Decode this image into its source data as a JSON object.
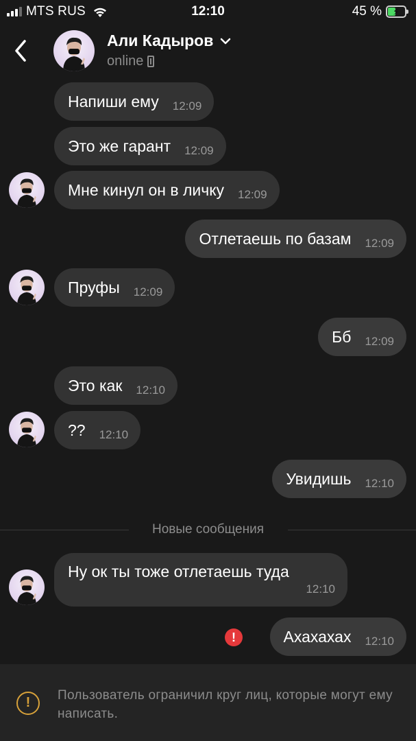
{
  "status_bar": {
    "carrier": "MTS RUS",
    "time": "12:10",
    "battery_percent": "45 %",
    "battery_level": 0.45,
    "icons": [
      "signal-icon",
      "wifi-icon",
      "battery-charging-icon"
    ]
  },
  "header": {
    "contact_name": "Али Кадыров",
    "status": "online",
    "icons": [
      "back-chevron-icon",
      "chevron-down-icon",
      "mobile-phone-icon"
    ]
  },
  "messages": [
    {
      "direction": "in",
      "text": "Напиши ему",
      "time": "12:09"
    },
    {
      "direction": "in",
      "text": "Это же гарант",
      "time": "12:09"
    },
    {
      "direction": "in",
      "text": "Мне кинул он в личку",
      "time": "12:09"
    },
    {
      "direction": "out",
      "text": "Отлетаешь по базам",
      "time": "12:09"
    },
    {
      "direction": "in",
      "text": "Пруфы",
      "time": "12:09"
    },
    {
      "direction": "out",
      "text": "Бб",
      "time": "12:09"
    },
    {
      "direction": "in",
      "text": "Это как",
      "time": "12:10"
    },
    {
      "direction": "in",
      "text": "??",
      "time": "12:10"
    },
    {
      "direction": "out",
      "text": "Увидишь",
      "time": "12:10"
    },
    {
      "direction": "in",
      "text": "Ну ок ты тоже отлетаешь туда",
      "time": "12:10"
    },
    {
      "direction": "out",
      "text": "Ахахахах",
      "time": "12:10",
      "error": true
    }
  ],
  "divider": {
    "label": "Новые сообщения"
  },
  "error_mark": "!",
  "notice": {
    "icon": "warning-icon",
    "icon_glyph": "!",
    "text": "Пользователь ограничил круг лиц, которые могут ему написать."
  },
  "colors": {
    "background": "#191919",
    "bubble": "#333333",
    "error": "#e5393b",
    "warning": "#d7a13a",
    "battery": "#4cd964"
  }
}
